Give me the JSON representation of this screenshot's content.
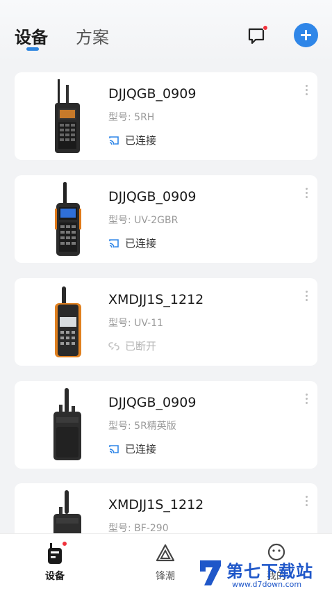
{
  "header": {
    "tabs": [
      {
        "label": "设备",
        "active": true
      },
      {
        "label": "方案",
        "active": false
      }
    ],
    "message_icon": "chat-bubble-icon",
    "add_icon": "plus-icon",
    "accent_color": "#2f86e8",
    "notification_dot_color": "#f0323c"
  },
  "devices": [
    {
      "name": "DJJQGB_0909",
      "model": "型号: 5RH",
      "status": "已连接",
      "connected": true
    },
    {
      "name": "DJJQGB_0909",
      "model": "型号: UV-2GBR",
      "status": "已连接",
      "connected": true
    },
    {
      "name": "XMDJJ1S_1212",
      "model": "型号: UV-11",
      "status": "已断开",
      "connected": false
    },
    {
      "name": "DJJQGB_0909",
      "model": "型号: 5R精英版",
      "status": "已连接",
      "connected": true
    },
    {
      "name": "XMDJJ1S_1212",
      "model": "型号: BF-290",
      "status": "",
      "connected": null
    }
  ],
  "bottom_nav": [
    {
      "label": "设备",
      "icon": "walkie-talkie-icon",
      "active": true
    },
    {
      "label": "锋潮",
      "icon": "triangle-icon",
      "active": false
    },
    {
      "label": "我的",
      "icon": "face-icon",
      "active": false
    }
  ],
  "watermark": {
    "title": "第七下载站",
    "url": "www.d7down.com"
  }
}
